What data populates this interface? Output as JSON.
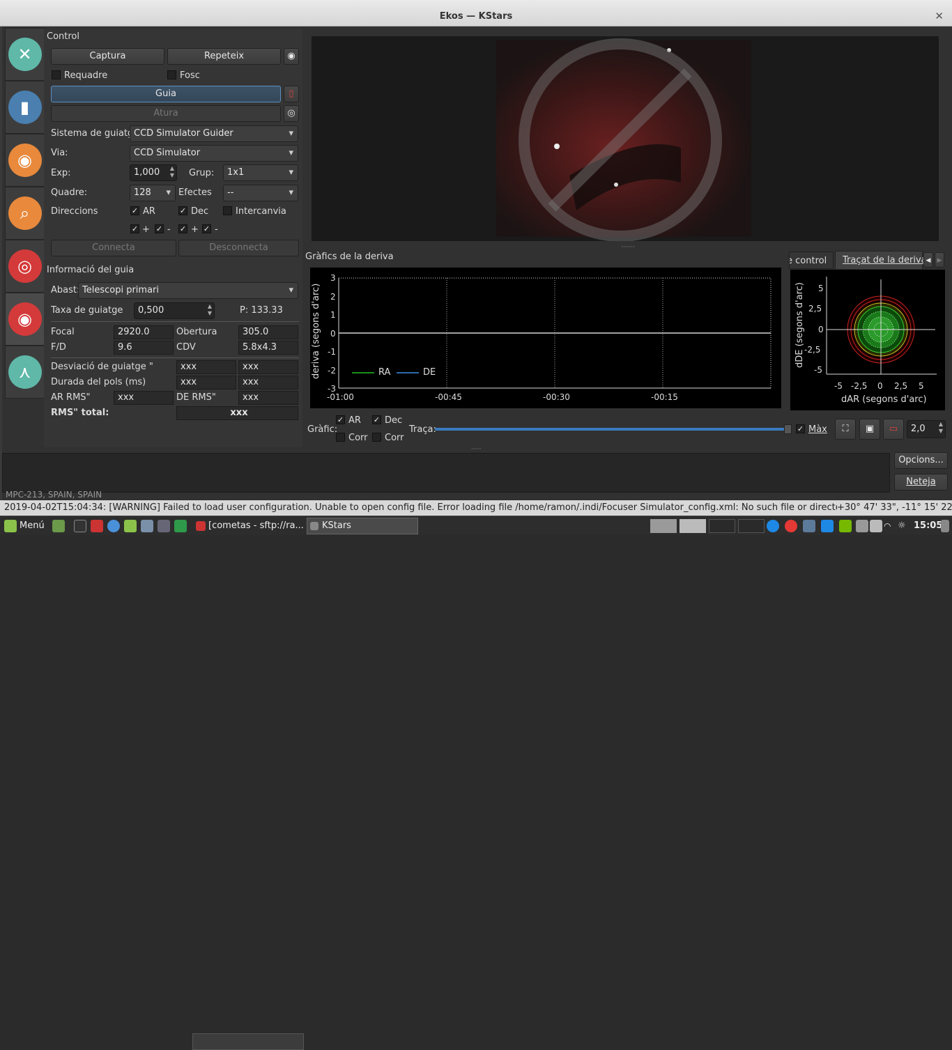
{
  "window": {
    "title": "Ekos — KStars",
    "close_glyph": "✕"
  },
  "modules": [
    {
      "name": "setup",
      "icon": "wrench-screwdriver-icon",
      "color": "#5fb8a8",
      "glyph": "✕"
    },
    {
      "name": "scheduler",
      "icon": "notebook-icon",
      "color": "#4a7fb0",
      "glyph": "▮"
    },
    {
      "name": "capture",
      "icon": "camera-icon",
      "color": "#e8893c",
      "glyph": "◉"
    },
    {
      "name": "focus",
      "icon": "magnifier-icon",
      "color": "#e8893c",
      "glyph": "⌕"
    },
    {
      "name": "align",
      "icon": "target-icon",
      "color": "#d43a3a",
      "glyph": "◎"
    },
    {
      "name": "guide",
      "icon": "compass-icon",
      "color": "#d43a3a",
      "glyph": "◉"
    },
    {
      "name": "mount",
      "icon": "tripod-icon",
      "color": "#5fb8a8",
      "glyph": "⋏"
    }
  ],
  "control": {
    "title": "Control",
    "capture_btn": "Captura",
    "loop_btn": "Repeteix",
    "subframe_label": "Requadre",
    "dark_label": "Fosc",
    "guide_btn": "Guia",
    "stop_btn": "Atura",
    "guider_label": "Sistema de guiatge:",
    "guider_value": "CCD Simulator Guider",
    "via_label": "Via:",
    "via_value": "CCD Simulator",
    "exp_label": "Exp:",
    "exp_value": "1,000",
    "bin_label": "Grup:",
    "bin_value": "1x1",
    "box_label": "Quadre:",
    "box_value": "128",
    "effects_label": "Efectes",
    "effects_value": "--",
    "directions_label": "Direccions",
    "ar_label": "AR",
    "dec_label": "Dec",
    "swap_label": "Intercanvia",
    "plus": "+",
    "minus": "-",
    "connect_btn": "Connecta",
    "disconnect_btn": "Desconnecta"
  },
  "info": {
    "title": "Informació del guia",
    "scope_label": "Abast:",
    "scope_value": "Telescopi primari",
    "rate_label": "Taxa de guiatge",
    "rate_value": "0,500",
    "p_text": "P: 133.33",
    "focal_label": "Focal",
    "focal_value": "2920.0",
    "aperture_label": "Obertura",
    "aperture_value": "305.0",
    "fd_label": "F/D",
    "fd_value": "9.6",
    "fov_label": "CDV",
    "fov_value": "5.8x4.3",
    "dev_label": "Desviació de guiatge \"",
    "dev_ra": "xxx",
    "dev_de": "xxx",
    "pulse_label": "Durada del pols (ms)",
    "pulse_ra": "xxx",
    "pulse_de": "xxx",
    "ar_rms_label": "AR RMS\"",
    "ar_rms_value": "xxx",
    "de_rms_label": "DE RMS\"",
    "de_rms_value": "xxx",
    "total_rms_label": "RMS\" total:",
    "total_rms_value": "xxx"
  },
  "drift": {
    "title": "Gràfics de la deriva",
    "ylabel": "deriva (segons d'arc)",
    "yticks": [
      "3",
      "2",
      "1",
      "0",
      "-1",
      "-2",
      "-3"
    ],
    "xticks": [
      "-01:00",
      "-00:45",
      "-00:30",
      "-00:15"
    ],
    "legend_ra": "RA",
    "legend_de": "DE",
    "ra_color": "#22c022",
    "de_color": "#3a8ee6"
  },
  "tabs": {
    "control": "e control",
    "drift_trace": "Traçat de la deriva"
  },
  "scatter": {
    "xlabel": "dAR (segons d'arc)",
    "ylabel": "dDE (segons d'arc)",
    "ticks": [
      "5",
      "2,5",
      "0",
      "-2,5",
      "-5"
    ],
    "xticks": [
      "-5",
      "-2,5",
      "0",
      "2,5",
      "5"
    ]
  },
  "graph_opts": {
    "graph_label": "Gràfic:",
    "ar": "AR",
    "dec": "Dec",
    "corr1": "Corr",
    "corr2": "Corr",
    "trace_label": "Traça:",
    "max_label": "Màx",
    "zoom_value": "2,0"
  },
  "log": {
    "options_btn": "Opcions...",
    "clear_btn": "Neteja",
    "hidden_text": "MPC-213, SPAIN, SPAIN"
  },
  "statusbar": {
    "message": "2019-04-02T15:04:34: [WARNING] Failed to load user configuration. Unable to open config file. Error loading file /home/ramon/.indi/Focuser Simulator_config.xml: No such file or directory. To save user configuratic",
    "coords": "+30° 47' 33\", -11° 15' 22\""
  },
  "taskbar": {
    "menu": "Menú",
    "task1": "[cometas - sftp://ra...",
    "task2": "KStars",
    "clock": "15:05"
  }
}
